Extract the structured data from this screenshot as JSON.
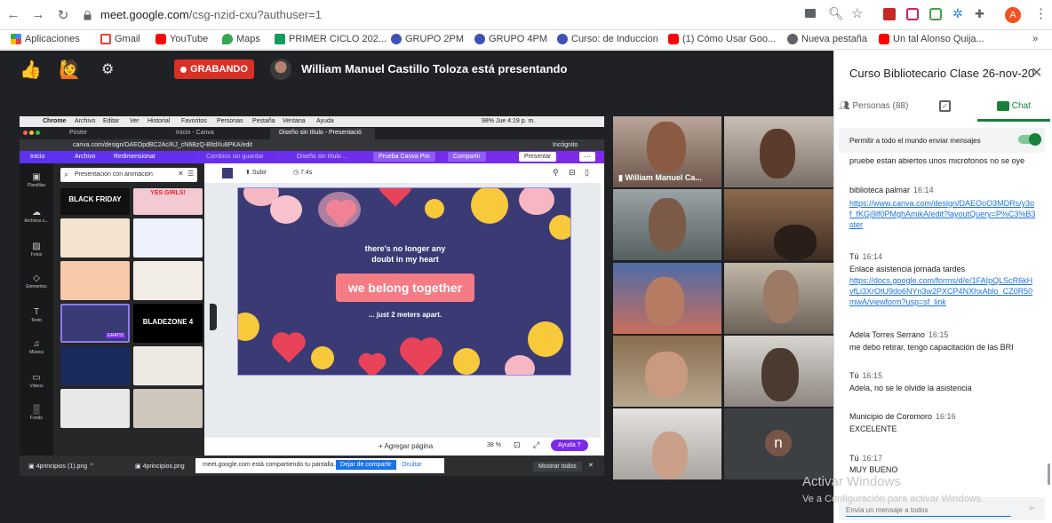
{
  "browser": {
    "url_host": "meet.google.com",
    "url_path": "/csg-nzid-cxu?authuser=1",
    "bookmarks": [
      "Aplicaciones",
      "Gmail",
      "YouTube",
      "Maps",
      "PRIMER CICLO 202...",
      "GRUPO 2PM",
      "GRUPO 4PM",
      "Curso: de Induccion",
      "(1) Cómo Usar Goo...",
      "Nueva pestaña",
      "Un tal Alonso Quija..."
    ],
    "more": "»",
    "profile_initial": "A"
  },
  "meet": {
    "recording_label": "GRABANDO",
    "presenter_text": "William Manuel Castillo Toloza está presentando",
    "participant_tile_name": "William Manuel Ca...",
    "avatar_initial": "n"
  },
  "shared": {
    "mac_menu": [
      "Chrome",
      "Archivo",
      "Editar",
      "Ver",
      "Historial",
      "Favoritos",
      "Personas",
      "Pestaña",
      "Ventana",
      "Ayuda"
    ],
    "mac_status": "98%  Jue 4:19 p. m.",
    "tabs": [
      "Póster",
      "Inicio - Canva",
      "Diseño sin título - Presentació"
    ],
    "address": "canva.com/design/DAEOpdBC2Ac/KJ_cN6BzQ-BltdXu8PKA/edit",
    "incognito": "Incógnito",
    "canva_bar": {
      "home": "Inicio",
      "file": "Archivo",
      "resize": "Redimensionar",
      "save": "Cambios sin guardar",
      "title": "Diseño sin título ...",
      "pro": "Prueba Canva Pro",
      "share": "Compartir",
      "present": "Presentar"
    },
    "sidebar": [
      "Plantillas",
      "Archivos s...",
      "Fotos",
      "Elementos",
      "Texto",
      "Música",
      "Videos",
      "Fondo"
    ],
    "search_value": "Presentación con animación",
    "toolbar": {
      "upload": "Subir",
      "duration": "7.4s"
    },
    "thumb_labels": [
      "BLACK FRIDAY",
      "YES GIRLS!",
      "BLADEZONE 4",
      "GRATIS"
    ],
    "slide": {
      "line1": "there's no longer any",
      "line2": "doubt in my heart",
      "headline": "we belong together",
      "footer": "... just 2 meters apart."
    },
    "add_page": "+ Agregar página",
    "zoom": "38 %",
    "help": "Ayuda ?",
    "taskbar": {
      "file1": "4principios (1).png",
      "file2": "4principios.png",
      "notice": "meet.google.com está compartiendo tu pantalla.",
      "stop": "Dejar de compartir",
      "hide": "Ocultar",
      "show_all": "Mostrar todos"
    }
  },
  "panel": {
    "title": "Curso Bibliotecario Clase 26-nov-20",
    "people_tab": "Personas (88)",
    "chat_tab": "Chat",
    "allow_label": "Permitir a todo el mundo enviar mensajes",
    "partial_message": "pruebe estan abiertos unos micrófonos no se oye",
    "messages": [
      {
        "name": "biblioteca palmar",
        "time": "16:14",
        "link": "https://www.canva.com/design/DAEOoO3MDRs/y3of_fKGj9lf0PMghAmikA/edit?layoutQuery=P%C3%B3ster"
      },
      {
        "name": "Tú",
        "time": "16:14",
        "text": "Enlace asistencia jornada tardes",
        "link": "https://docs.google.com/forms/d/e/1FAIpQLScR6kHvfLi3XrOtU9do6NYn3w2PXCP4NXhxAblo_CZ0R50mwA/viewform?usp=sf_link"
      },
      {
        "name": "Adela Torres Serrano",
        "time": "16:15",
        "text": "me debo retirar, tengo capacitación de las BRI"
      },
      {
        "name": "Tú",
        "time": "16:15",
        "text": "Adela, no se le olvide la asistencia"
      },
      {
        "name": "Municipio de Coromoro",
        "time": "16:16",
        "text": "EXCELENTE"
      },
      {
        "name": "Tú",
        "time": "16:17",
        "text": "MUY BUENO"
      }
    ],
    "input_placeholder": "Envía un mensaje a todos",
    "watermark1": "Activar Windows",
    "watermark2": "Ve a Configuración para activar Windows."
  }
}
